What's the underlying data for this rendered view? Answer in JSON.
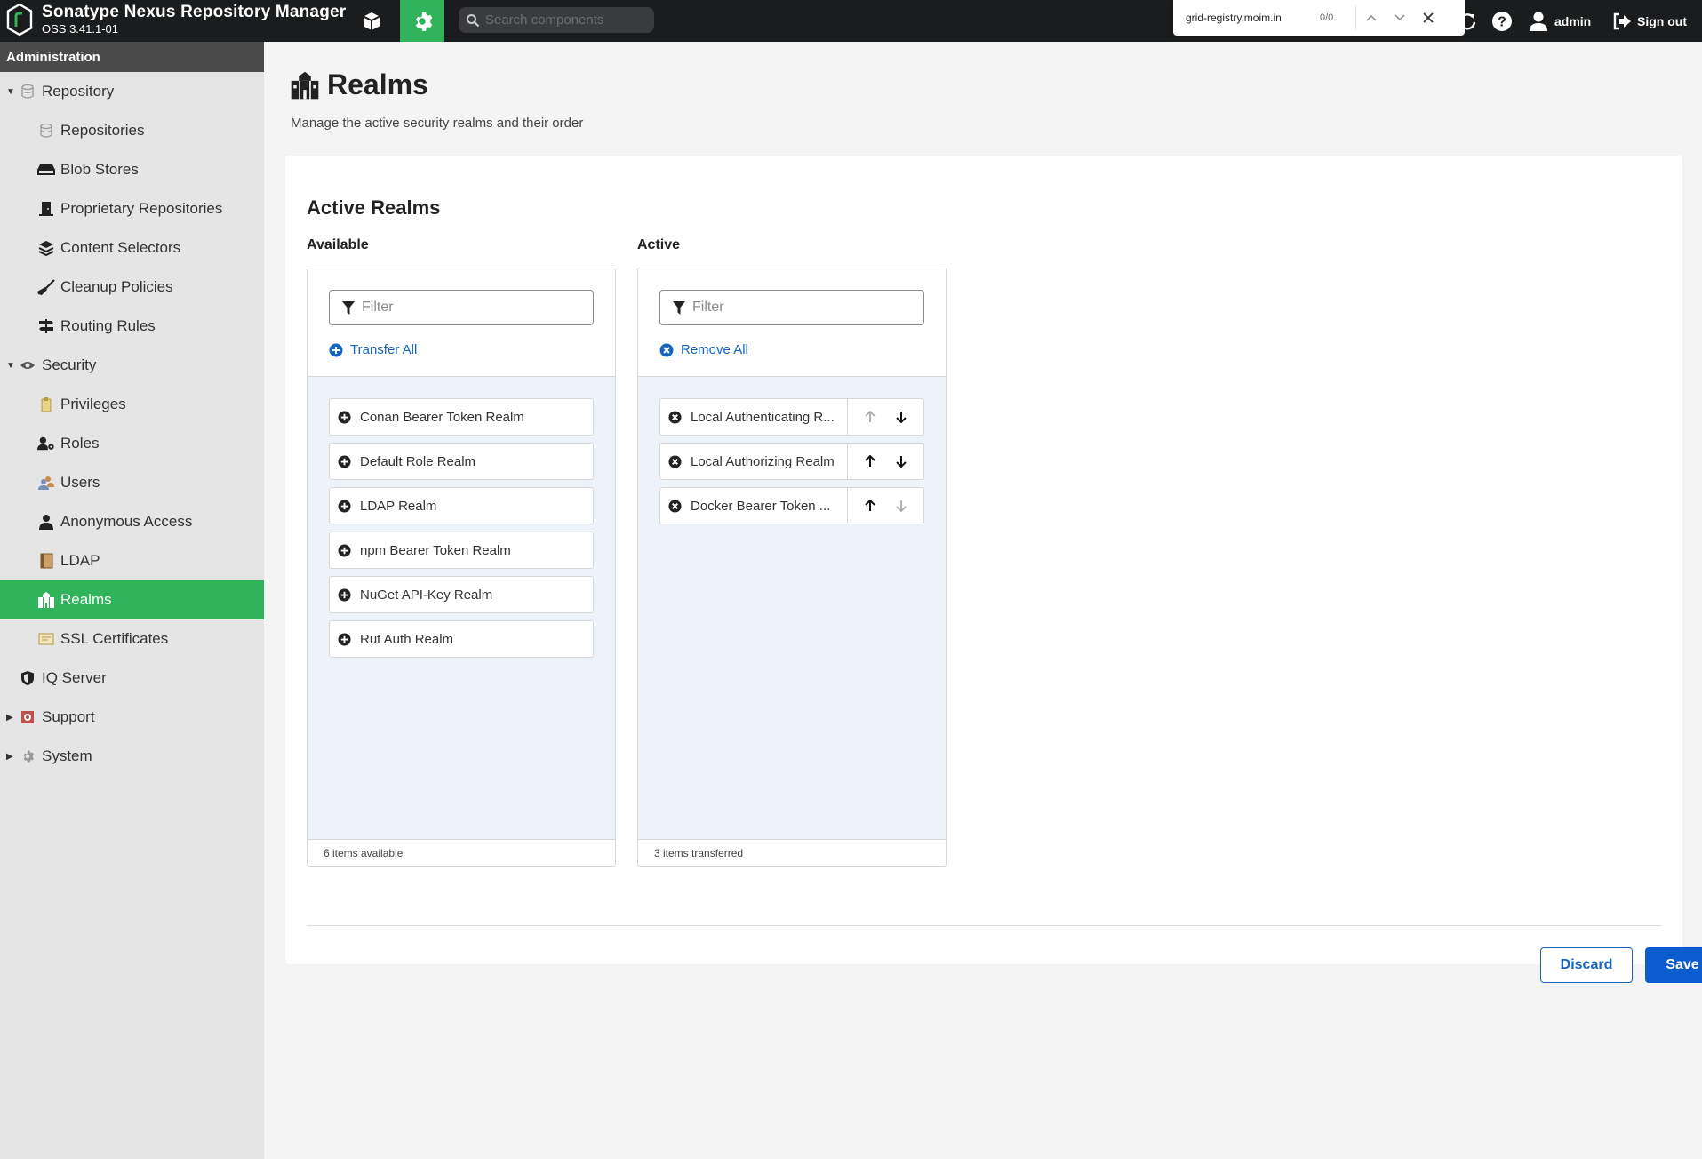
{
  "app": {
    "title": "Sonatype Nexus Repository Manager",
    "version": "OSS 3.41.1-01",
    "search_placeholder": "Search components",
    "user": "admin",
    "sign_out": "Sign out",
    "accent": "#2fb35b"
  },
  "findbar": {
    "value": "grid-registry.moim.in",
    "count": "0/0"
  },
  "sidebar": {
    "header": "Administration",
    "items": [
      {
        "label": "Repository",
        "level": 1,
        "caret": "down",
        "icon": "database-icon"
      },
      {
        "label": "Repositories",
        "level": 2,
        "icon": "database-icon"
      },
      {
        "label": "Blob Stores",
        "level": 2,
        "icon": "hard-drive-icon"
      },
      {
        "label": "Proprietary Repositories",
        "level": 2,
        "icon": "door-icon"
      },
      {
        "label": "Content Selectors",
        "level": 2,
        "icon": "layers-icon"
      },
      {
        "label": "Cleanup Policies",
        "level": 2,
        "icon": "broom-icon"
      },
      {
        "label": "Routing Rules",
        "level": 2,
        "icon": "signpost-icon"
      },
      {
        "label": "Security",
        "level": 1,
        "caret": "down",
        "icon": "eye-icon"
      },
      {
        "label": "Privileges",
        "level": 2,
        "icon": "badge-icon"
      },
      {
        "label": "Roles",
        "level": 2,
        "icon": "user-gear-icon"
      },
      {
        "label": "Users",
        "level": 2,
        "icon": "users-icon"
      },
      {
        "label": "Anonymous Access",
        "level": 2,
        "icon": "user-icon"
      },
      {
        "label": "LDAP",
        "level": 2,
        "icon": "book-icon"
      },
      {
        "label": "Realms",
        "level": 2,
        "icon": "realm-icon",
        "active": true
      },
      {
        "label": "SSL Certificates",
        "level": 2,
        "icon": "certificate-icon"
      },
      {
        "label": "IQ Server",
        "level": 1,
        "caret": "none",
        "icon": "shield-icon"
      },
      {
        "label": "Support",
        "level": 1,
        "caret": "right",
        "icon": "lifebuoy-icon"
      },
      {
        "label": "System",
        "level": 1,
        "caret": "right",
        "icon": "gear-icon"
      }
    ]
  },
  "page": {
    "title": "Realms",
    "subtitle": "Manage the active security realms and their order",
    "section_title": "Active Realms"
  },
  "available": {
    "label": "Available",
    "filter_placeholder": "Filter",
    "action": "Transfer All",
    "items": [
      "Conan Bearer Token Realm",
      "Default Role Realm",
      "LDAP Realm",
      "npm Bearer Token Realm",
      "NuGet API-Key Realm",
      "Rut Auth Realm"
    ],
    "footer": "6 items available"
  },
  "active": {
    "label": "Active",
    "filter_placeholder": "Filter",
    "action": "Remove All",
    "items": [
      {
        "label": "Local Authenticating R...",
        "up_enabled": false,
        "down_enabled": true
      },
      {
        "label": "Local Authorizing Realm",
        "up_enabled": true,
        "down_enabled": true
      },
      {
        "label": "Docker Bearer Token ...",
        "up_enabled": true,
        "down_enabled": false
      }
    ],
    "footer": "3 items transferred"
  },
  "buttons": {
    "discard": "Discard",
    "save": "Save"
  }
}
